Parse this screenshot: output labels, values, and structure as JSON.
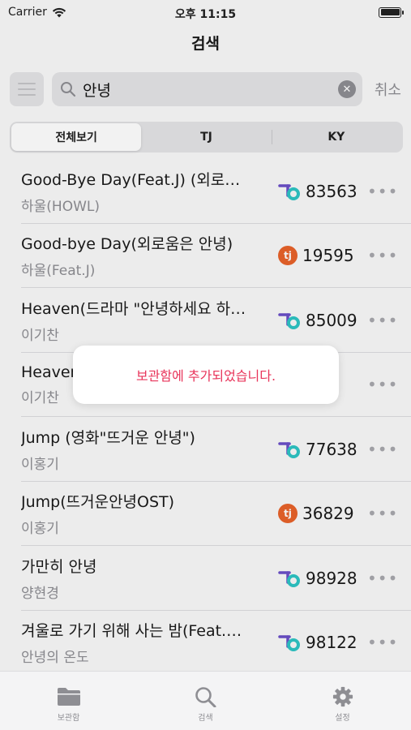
{
  "status": {
    "carrier": "Carrier",
    "time": "오후 11:15"
  },
  "nav": {
    "title": "검색"
  },
  "search": {
    "value": "안녕",
    "cancel_label": "취소"
  },
  "segments": [
    "전체보기",
    "TJ",
    "KY"
  ],
  "songs": [
    {
      "title": "Good-Bye Day(Feat.J) (외로움은 안녕)",
      "artist": "하울(HOWL)",
      "brand": "KY",
      "number": "83563"
    },
    {
      "title": "Good-bye Day(외로움은 안녕)",
      "artist": "하울(Feat.J)",
      "brand": "TJ",
      "number": "19595"
    },
    {
      "title": "Heaven(드라마 \"안녕하세요 하나님\")",
      "artist": "이기찬",
      "brand": "KY",
      "number": "85009"
    },
    {
      "title": "Heaven",
      "artist": "이기찬",
      "brand": "",
      "number": ""
    },
    {
      "title": "Jump (영화\"뜨거운 안녕\")",
      "artist": "이홍기",
      "brand": "KY",
      "number": "77638"
    },
    {
      "title": "Jump(뜨거운안녕OST)",
      "artist": "이홍기",
      "brand": "TJ",
      "number": "36829"
    },
    {
      "title": "가만히 안녕",
      "artist": "양현경",
      "brand": "KY",
      "number": "98928"
    },
    {
      "title": "겨울로 가기 위해 사는 밤(Feat.안녕의 온도)",
      "artist": "안녕의 온도",
      "brand": "KY",
      "number": "98122"
    }
  ],
  "toast": {
    "message": "보관함에 추가되었습니다."
  },
  "tabs": [
    {
      "label": "보관함",
      "icon": "folder-icon"
    },
    {
      "label": "검색",
      "icon": "search-icon"
    },
    {
      "label": "설정",
      "icon": "gear-icon"
    }
  ],
  "colors": {
    "accent": "#e8345a",
    "tj": "#e8622a",
    "ky_teal": "#2ec4c4",
    "ky_purple": "#6a4fc8"
  }
}
